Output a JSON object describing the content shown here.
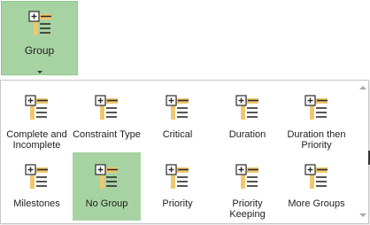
{
  "ribbon": {
    "group_button": {
      "label": "Group",
      "icon": "group-by-icon"
    }
  },
  "gallery": {
    "items": [
      {
        "label": "Complete and\nIncomplete",
        "icon": "group-by-icon",
        "selected": false
      },
      {
        "label": "Constraint Type",
        "icon": "group-by-icon",
        "selected": false
      },
      {
        "label": "Critical",
        "icon": "group-by-icon",
        "selected": false
      },
      {
        "label": "Duration",
        "icon": "group-by-icon",
        "selected": false
      },
      {
        "label": "Duration then\nPriority",
        "icon": "group-by-icon",
        "selected": false
      },
      {
        "label": "Milestones",
        "icon": "group-by-icon",
        "selected": false
      },
      {
        "label": "No Group",
        "icon": "group-by-icon",
        "selected": true
      },
      {
        "label": "Priority",
        "icon": "group-by-icon",
        "selected": false
      },
      {
        "label": "Priority\nKeeping",
        "icon": "group-by-icon",
        "selected": false
      },
      {
        "label": "More Groups",
        "icon": "group-by-icon",
        "selected": false
      }
    ]
  },
  "colors": {
    "selected_bg": "#a7d3a2",
    "icon_orange": "#f0c76e",
    "icon_dark": "#2b2b2b"
  }
}
